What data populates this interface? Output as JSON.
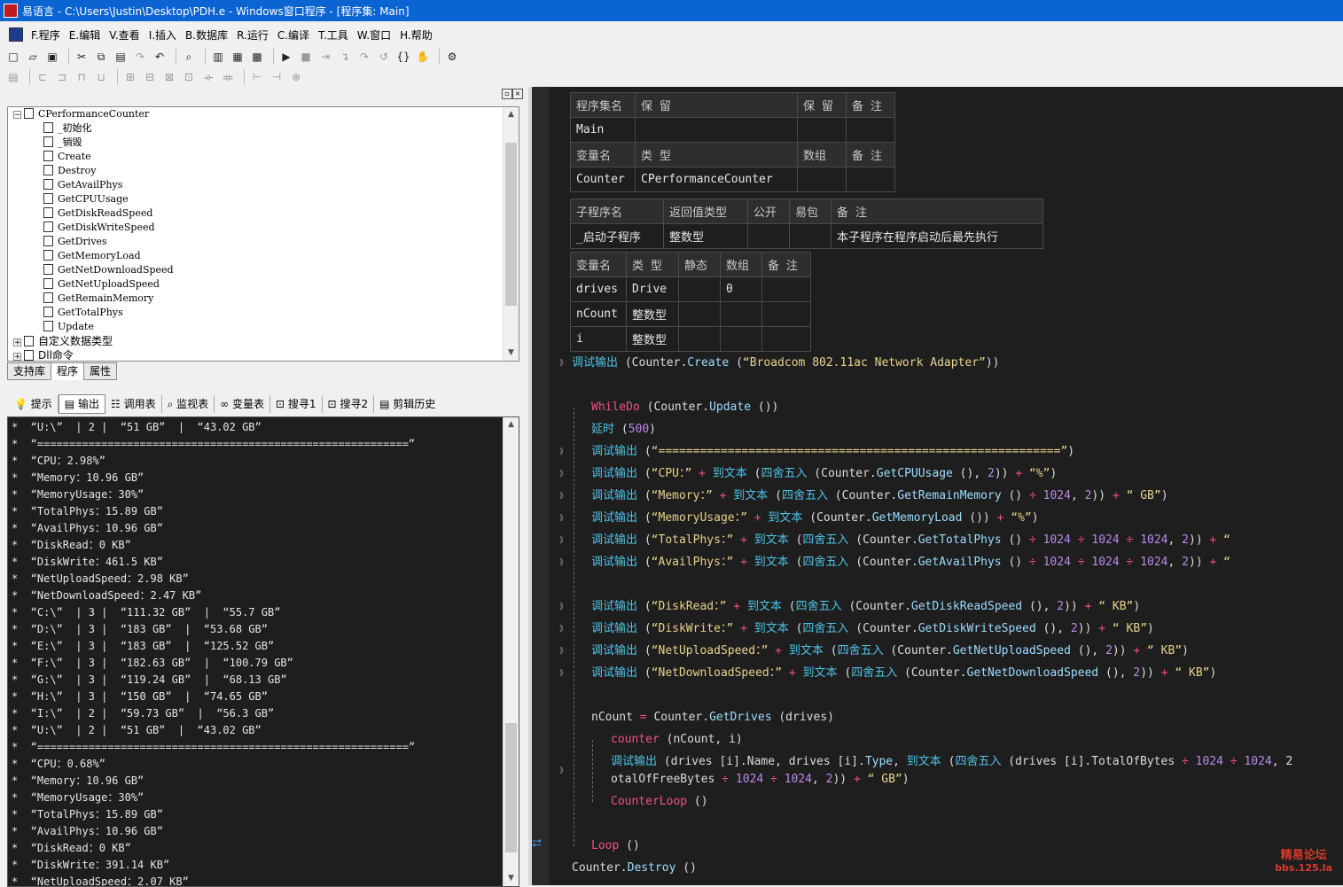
{
  "window": {
    "title": "易语言 - C:\\Users\\Justin\\Desktop\\PDH.e - Windows窗口程序 - [程序集: Main]"
  },
  "menu": [
    "F.程序",
    "E.编辑",
    "V.查看",
    "I.插入",
    "B.数据库",
    "R.运行",
    "C.编译",
    "T.工具",
    "W.窗口",
    "H.帮助"
  ],
  "tree": {
    "root": "CPerformanceCounter",
    "items": [
      "_初始化",
      "_销毁",
      "Create",
      "Destroy",
      "GetAvailPhys",
      "GetCPUUsage",
      "GetDiskReadSpeed",
      "GetDiskWriteSpeed",
      "GetDrives",
      "GetMemoryLoad",
      "GetNetDownloadSpeed",
      "GetNetUploadSpeed",
      "GetRemainMemory",
      "GetTotalPhys",
      "Update"
    ],
    "other1": "自定义数据类型",
    "other2": "Dll命令"
  },
  "left_tabs": [
    "支持库",
    "程序",
    "属性"
  ],
  "output_tabs": [
    "提示",
    "输出",
    "调用表",
    "监视表",
    "变量表",
    "搜寻1",
    "搜寻2",
    "剪辑历史"
  ],
  "output_lines": [
    "*  “U:\\”  | 2 |  “51 GB”  |  “43.02 GB”",
    "*  “==========================================================”",
    "*  “CPU：2.98%”",
    "*  “Memory：10.96 GB”",
    "*  “MemoryUsage：30%”",
    "*  “TotalPhys：15.89 GB”",
    "*  “AvailPhys：10.96 GB”",
    "*  “DiskRead：0 KB”",
    "*  “DiskWrite：461.5 KB”",
    "*  “NetUploadSpeed：2.98 KB”",
    "*  “NetDownloadSpeed：2.47 KB”",
    "*  “C:\\”  | 3 |  “111.32 GB”  |  “55.7 GB”",
    "*  “D:\\”  | 3 |  “183 GB”  |  “53.68 GB”",
    "*  “E:\\”  | 3 |  “183 GB”  |  “125.52 GB”",
    "*  “F:\\”  | 3 |  “182.63 GB”  |  “100.79 GB”",
    "*  “G:\\”  | 3 |  “119.24 GB”  |  “68.13 GB”",
    "*  “H:\\”  | 3 |  “150 GB”  |  “74.65 GB”",
    "*  “I:\\”  | 2 |  “59.73 GB”  |  “56.3 GB”",
    "*  “U:\\”  | 2 |  “51 GB”  |  “43.02 GB”",
    "*  “==========================================================”",
    "*  “CPU：0.68%”",
    "*  “Memory：10.96 GB”",
    "*  “MemoryUsage：30%”",
    "*  “TotalPhys：15.89 GB”",
    "*  “AvailPhys：10.96 GB”",
    "*  “DiskRead：0 KB”",
    "*  “DiskWrite：391.14 KB”",
    "*  “NetUploadSpeed：2.07 KB”"
  ],
  "editor": {
    "table1": {
      "h1": [
        "程序集名",
        "保 留",
        "保 留",
        "备 注"
      ],
      "r1": [
        "Main",
        "",
        "",
        ""
      ],
      "h2": [
        "变量名",
        "类 型",
        "数组",
        "备 注"
      ],
      "r2": [
        "Counter",
        "CPerformanceCounter",
        "",
        ""
      ]
    },
    "table2": {
      "h": [
        "子程序名",
        "返回值类型",
        "公开",
        "易包",
        "备 注"
      ],
      "r": [
        "_启动子程序",
        "整数型",
        "",
        "",
        "本子程序在程序启动后最先执行"
      ]
    },
    "table3": {
      "h": [
        "变量名",
        "类 型",
        "静态",
        "数组",
        "备 注"
      ],
      "rows": [
        [
          "drives",
          "Drive",
          "",
          "0",
          ""
        ],
        [
          "nCount",
          "整数型",
          "",
          "",
          ""
        ],
        [
          "i",
          "整数型",
          "",
          "",
          ""
        ]
      ]
    }
  },
  "watermark": {
    "line1": "精易论坛",
    "line2": "bbs.125.la"
  }
}
